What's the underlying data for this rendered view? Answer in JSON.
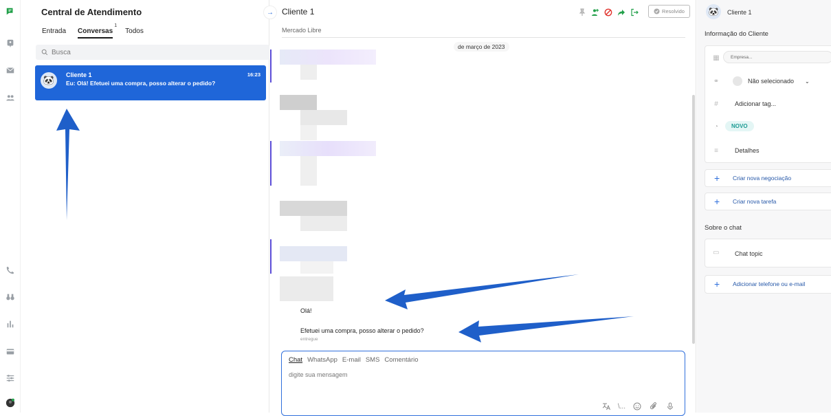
{
  "rail": {
    "icons": [
      "chat-icon",
      "support-icon",
      "mail-icon",
      "contacts-icon",
      "phone-icon",
      "binoculars-icon",
      "reports-icon",
      "billing-icon",
      "settings-icon",
      "user-avatar-icon"
    ]
  },
  "list": {
    "title": "Central de Atendimento",
    "tabs": [
      {
        "label": "Entrada"
      },
      {
        "label": "Conversas",
        "count": "1"
      },
      {
        "label": "Todos"
      }
    ],
    "search_placeholder": "Busca",
    "conversation": {
      "name": "Cliente 1",
      "time": "16:23",
      "preview": "Eu: Olá! Efetuei uma compra, posso alterar o pedido?"
    }
  },
  "chat": {
    "name": "Cliente 1",
    "subtitle": "Mercado Libre",
    "resolved_label": "Resolvido",
    "date_pill": "de março de 2023",
    "messages": [
      {
        "text": "Olá!"
      },
      {
        "text": "Efetuei uma compra, posso alterar o pedido?",
        "status": "entregue"
      }
    ],
    "composer": {
      "tabs": [
        "Chat",
        "WhatsApp",
        "E-mail",
        "SMS",
        "Comentário"
      ],
      "placeholder": "digite sua mensagem",
      "signature_label": "\\..."
    }
  },
  "info": {
    "name": "Cliente 1",
    "section_client": "Informação do Cliente",
    "company_placeholder": "Empresa...",
    "owner": "Não selecionado",
    "tags_label": "Adicionar tag...",
    "status_badge": "NOVO",
    "details_label": "Detalhes",
    "new_deal": "Criar nova negociação",
    "new_task": "Criar nova tarefa",
    "section_chat": "Sobre o chat",
    "chat_topic": "Chat topic",
    "add_contact": "Adicionar telefone ou e-mail"
  },
  "colors": {
    "accent": "#1f66d9",
    "arrow": "#1f5fc9",
    "success": "#22a04a",
    "danger": "#e0302a"
  }
}
